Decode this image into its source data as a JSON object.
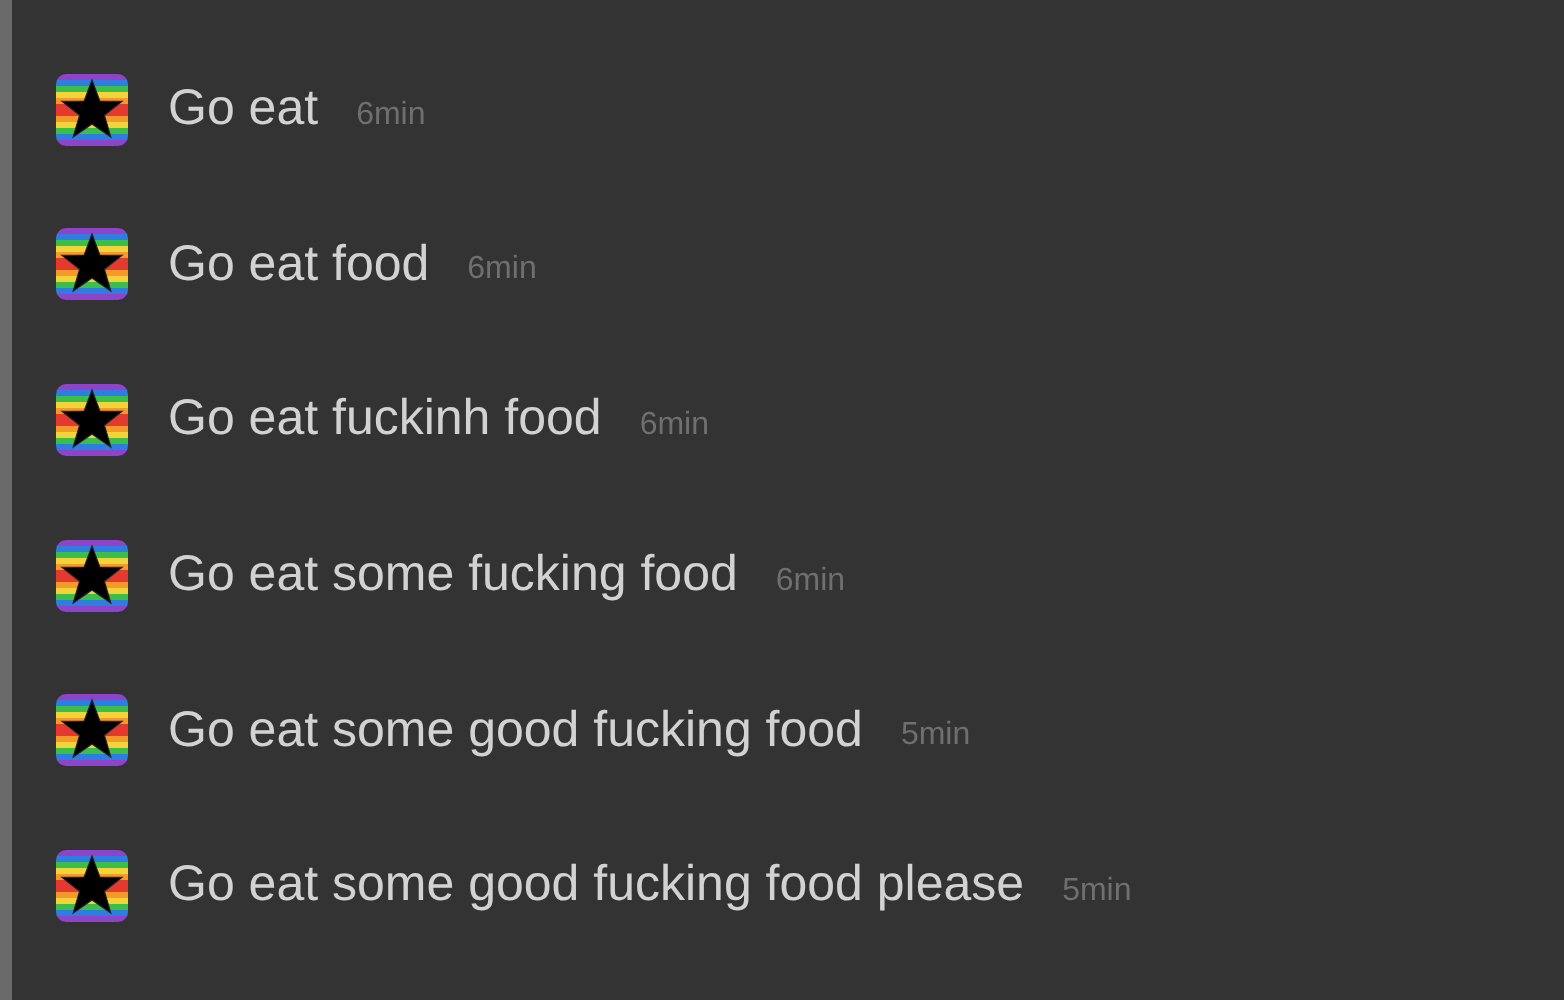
{
  "messages": [
    {
      "text": "Go eat",
      "time": "6min"
    },
    {
      "text": "Go eat food",
      "time": "6min"
    },
    {
      "text": "Go eat fuckinh food",
      "time": "6min"
    },
    {
      "text": "Go eat some fucking food",
      "time": "6min"
    },
    {
      "text": "Go eat some good fucking food",
      "time": "5min"
    },
    {
      "text": "Go eat some good fucking food please",
      "time": "5min"
    }
  ]
}
